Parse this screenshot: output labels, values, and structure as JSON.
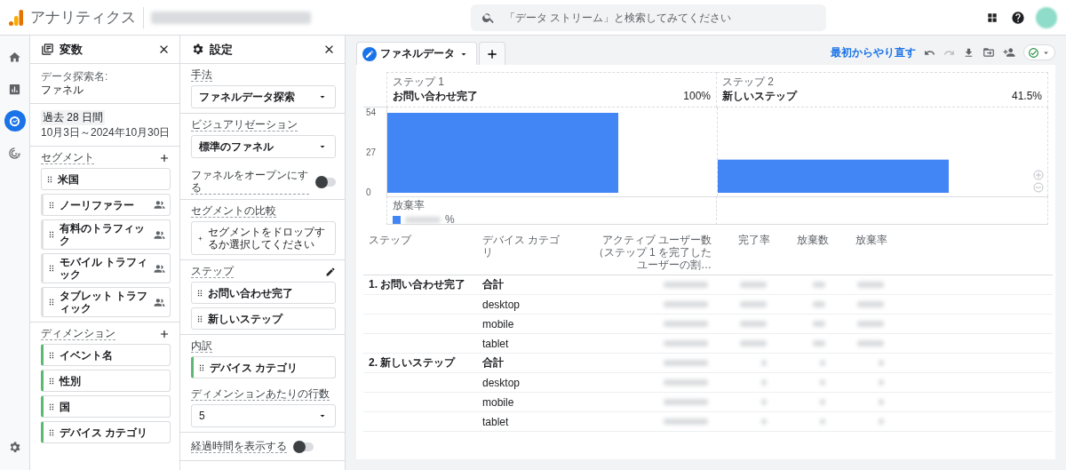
{
  "app": {
    "title": "アナリティクス",
    "search": {
      "placeholder": "「データ ストリーム」と検索してみてください"
    }
  },
  "nav": [
    {
      "kind": "home",
      "selected": false
    },
    {
      "kind": "reports",
      "selected": false
    },
    {
      "kind": "explore",
      "selected": true
    },
    {
      "kind": "advertising",
      "selected": false
    }
  ],
  "variables": {
    "title": "変数",
    "name_label": "データ探索名:",
    "name": "ファネル",
    "date_range": {
      "label": "過去 28 日間",
      "value": "10月3日～2024年10月30日"
    },
    "segments": {
      "title": "セグメント",
      "items": [
        {
          "label": "米国",
          "kind": "plain"
        },
        {
          "label": "ノーリファラー",
          "kind": "user"
        },
        {
          "label": "有料のトラフィック",
          "kind": "user"
        },
        {
          "label": "モバイル トラフィック",
          "kind": "user"
        },
        {
          "label": "タブレット トラフィック",
          "kind": "user"
        }
      ]
    },
    "dimensions": {
      "title": "ディメンション",
      "items": [
        "イベント名",
        "性別",
        "国",
        "デバイス カテゴリ"
      ]
    }
  },
  "settings": {
    "title": "設定",
    "technique": {
      "label": "手法",
      "value": "ファネルデータ探索"
    },
    "visualization": {
      "label": "ビジュアリゼーション",
      "value": "標準のファネル"
    },
    "open_funnel": {
      "label": "ファネルをオープンにする",
      "on": false
    },
    "segment_compare": {
      "label": "セグメントの比較",
      "placeholder": "セグメントをドロップするか選択してください"
    },
    "steps": {
      "label": "ステップ",
      "items": [
        "お問い合わせ完了",
        "新しいステップ"
      ]
    },
    "breakdown": {
      "label": "内訳",
      "items": [
        "デバイス カテゴリ"
      ]
    },
    "rows_per_dimension": {
      "label": "ディメンションあたりの行数",
      "value": "5"
    },
    "elapsed_time": {
      "label": "経過時間を表示する",
      "on": false
    }
  },
  "tabs": [
    {
      "label": "ファネルデータ",
      "selected": true
    }
  ],
  "toolbar": {
    "reset": "最初からやり直す"
  },
  "funnel": {
    "steps": [
      {
        "label": "ステップ 1",
        "name": "お問い合わせ完了",
        "rate": "100%"
      },
      {
        "label": "ステップ 2",
        "name": "新しいステップ",
        "rate": "41.5%"
      }
    ],
    "abandon_label": "放棄率",
    "abandon_suffix": "%",
    "chart_data": {
      "type": "bar",
      "series": [
        {
          "color": "#4285f4",
          "values": [
            54,
            22.4
          ]
        }
      ],
      "ylim": [
        0,
        54
      ],
      "yticks": [
        0,
        27,
        54
      ]
    }
  },
  "table": {
    "columns": [
      "ステップ",
      "デバイス カテゴリ",
      "アクティブ ユーザー数（ステップ 1 を完了したユーザーの割…",
      "完了率",
      "放棄数",
      "放棄率"
    ],
    "rows": [
      {
        "step": "1. お問い合わせ完了",
        "device": "合計",
        "total": true
      },
      {
        "step": "",
        "device": "desktop",
        "total": false
      },
      {
        "step": "",
        "device": "mobile",
        "total": false
      },
      {
        "step": "",
        "device": "tablet",
        "total": false
      },
      {
        "step": "2. 新しいステップ",
        "device": "合計",
        "total": true
      },
      {
        "step": "",
        "device": "desktop",
        "total": false
      },
      {
        "step": "",
        "device": "mobile",
        "total": false
      },
      {
        "step": "",
        "device": "tablet",
        "total": false
      }
    ]
  }
}
